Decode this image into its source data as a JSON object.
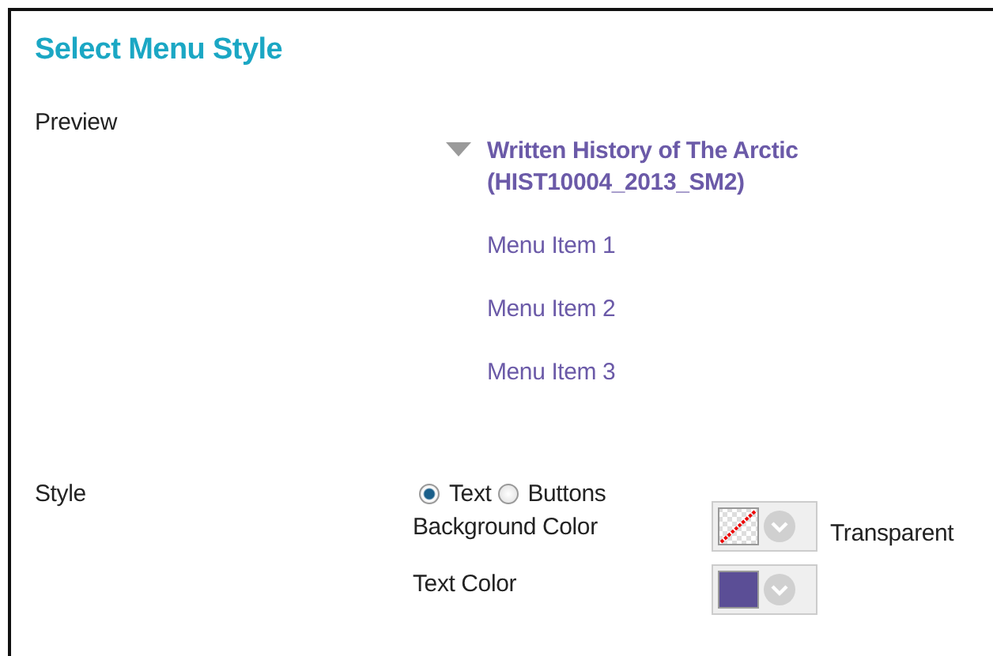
{
  "title": "Select Menu Style",
  "preview": {
    "label": "Preview",
    "menu_title": "Written History of The Arctic (HIST10004_2013_SM2)",
    "expanded": true,
    "items": [
      "Menu Item 1",
      "Menu Item 2",
      "Menu Item 3"
    ]
  },
  "style": {
    "label": "Style",
    "options": [
      {
        "label": "Text",
        "selected": true
      },
      {
        "label": "Buttons",
        "selected": false
      }
    ]
  },
  "colors": [
    {
      "label": "Background Color",
      "kind": "transparent",
      "value_text": "Transparent"
    },
    {
      "label": "Text Color",
      "kind": "solid",
      "color": "#5b4e96"
    }
  ]
}
